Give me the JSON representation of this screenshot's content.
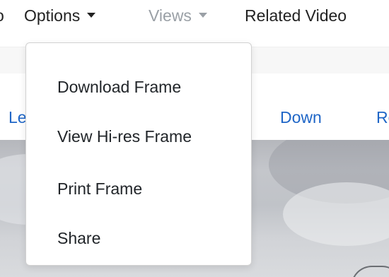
{
  "navbar": {
    "clipped_label": "o",
    "options_label": "Options",
    "views_label": "Views",
    "related_label": "Related Video"
  },
  "controls": {
    "left_label": "Le",
    "down_label": "Down",
    "right_label": "Re"
  },
  "options_menu": {
    "items": [
      {
        "label": "Download Frame"
      },
      {
        "label": "View Hi-res Frame"
      },
      {
        "label": "Print Frame"
      },
      {
        "label": "Share"
      }
    ]
  },
  "colors": {
    "link_blue": "#1f66c7",
    "muted_gray": "#9aa0a6",
    "text_dark": "#212529"
  },
  "icons": [
    "caret-down-icon"
  ]
}
